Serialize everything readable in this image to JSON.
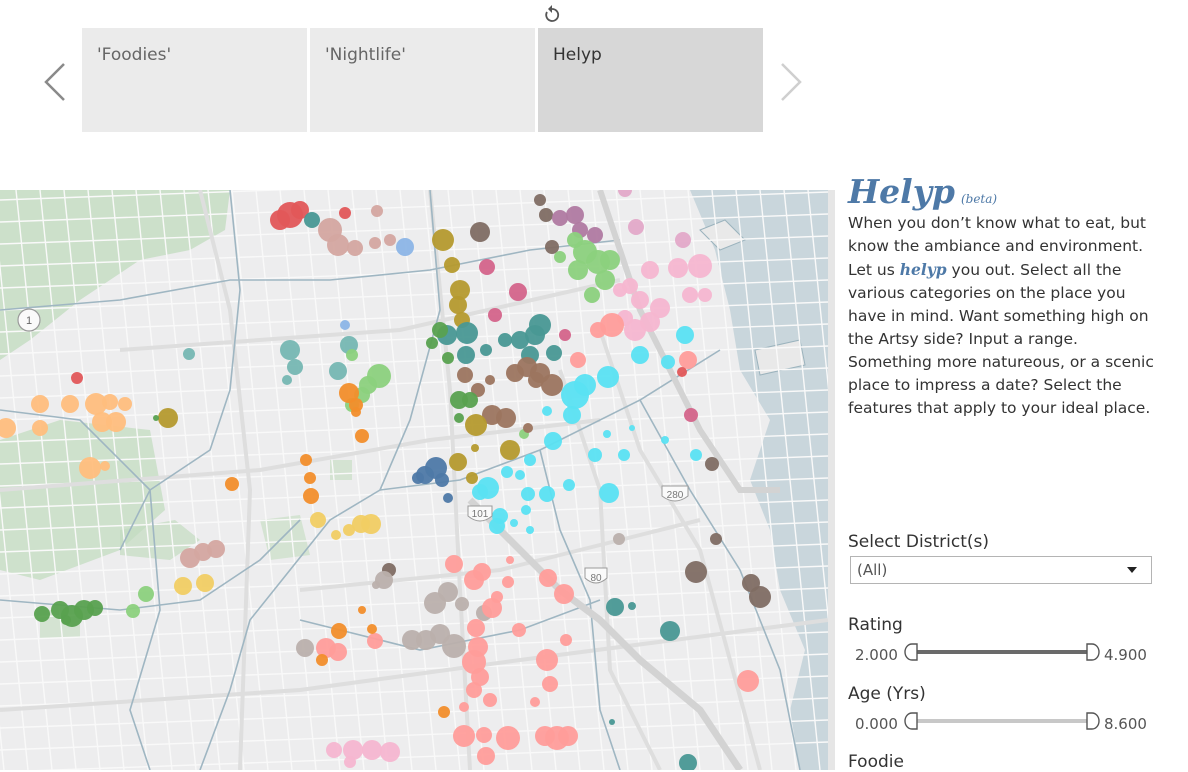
{
  "story": {
    "tabs": [
      {
        "label": "'Foodies'"
      },
      {
        "label": "'Nightlife'"
      },
      {
        "label": "Helyp"
      }
    ],
    "active_index": 2
  },
  "map": {
    "route_shield": "1",
    "freeway_shields": [
      "101",
      "80",
      "280"
    ]
  },
  "panel": {
    "title": "Helyp",
    "beta": "(beta)",
    "desc_before": "When you don’t know what to eat, but know the ambiance and environment. Let us ",
    "desc_em": "helyp",
    "desc_after": " you out. Select all the various categories on the place you have in mind. Want something high on the Artsy side? Input a range. Something more natureous, or a scenic place to impress a date? Select the features that apply to your ideal place."
  },
  "filters": {
    "district_label": "Select District(s)",
    "district_value": "(All)",
    "rating": {
      "label": "Rating",
      "min": "2.000",
      "max": "4.900"
    },
    "age": {
      "label": "Age (Yrs)",
      "min": "0.000",
      "max": "8.600"
    },
    "foodie_label": "Foodie"
  },
  "colors": {
    "accent": "#4e79a7",
    "tab_inactive": "#ebebeb",
    "tab_active": "#d7d7d7",
    "water": "#c9d6dc",
    "park": "#c3dcc0"
  }
}
